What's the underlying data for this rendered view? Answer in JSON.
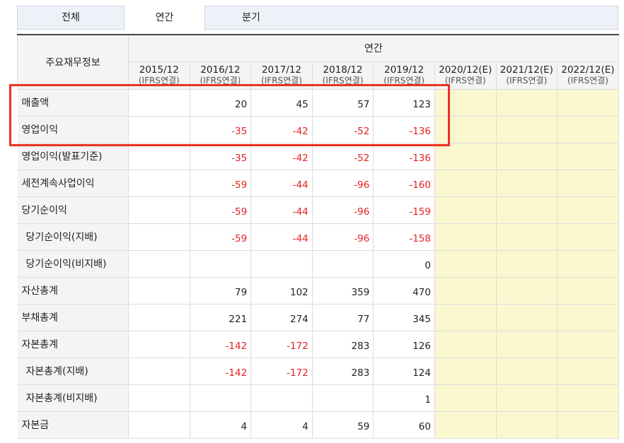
{
  "tabs": [
    {
      "label": "전체",
      "active": false
    },
    {
      "label": "연간",
      "active": true
    },
    {
      "label": "분기",
      "active": false
    }
  ],
  "table": {
    "row_header": "주요재무정보",
    "group_header": "연간",
    "columns": [
      {
        "year": "2015/12",
        "basis": "(IFRS연결)"
      },
      {
        "year": "2016/12",
        "basis": "(IFRS연결)"
      },
      {
        "year": "2017/12",
        "basis": "(IFRS연결)"
      },
      {
        "year": "2018/12",
        "basis": "(IFRS연결)"
      },
      {
        "year": "2019/12",
        "basis": "(IFRS연결)"
      },
      {
        "year": "2020/12(E)",
        "basis": "(IFRS연결)"
      },
      {
        "year": "2021/12(E)",
        "basis": "(IFRS연결)"
      },
      {
        "year": "2022/12(E)",
        "basis": "(IFRS연결)"
      }
    ],
    "rows": [
      {
        "label": "매출액",
        "indent": false,
        "values": [
          "",
          "20",
          "45",
          "57",
          "123",
          "",
          "",
          ""
        ]
      },
      {
        "label": "영업이익",
        "indent": false,
        "values": [
          "",
          "-35",
          "-42",
          "-52",
          "-136",
          "",
          "",
          ""
        ]
      },
      {
        "label": "영업이익(발표기준)",
        "indent": false,
        "values": [
          "",
          "-35",
          "-42",
          "-52",
          "-136",
          "",
          "",
          ""
        ]
      },
      {
        "label": "세전계속사업이익",
        "indent": false,
        "values": [
          "",
          "-59",
          "-44",
          "-96",
          "-160",
          "",
          "",
          ""
        ]
      },
      {
        "label": "당기순이익",
        "indent": false,
        "values": [
          "",
          "-59",
          "-44",
          "-96",
          "-159",
          "",
          "",
          ""
        ]
      },
      {
        "label": "당기순이익(지배)",
        "indent": true,
        "values": [
          "",
          "-59",
          "-44",
          "-96",
          "-158",
          "",
          "",
          ""
        ]
      },
      {
        "label": "당기순이익(비지배)",
        "indent": true,
        "values": [
          "",
          "",
          "",
          "",
          "0",
          "",
          "",
          ""
        ]
      },
      {
        "label": "자산총계",
        "indent": false,
        "values": [
          "",
          "79",
          "102",
          "359",
          "470",
          "",
          "",
          ""
        ]
      },
      {
        "label": "부채총계",
        "indent": false,
        "values": [
          "",
          "221",
          "274",
          "77",
          "345",
          "",
          "",
          ""
        ]
      },
      {
        "label": "자본총계",
        "indent": false,
        "values": [
          "",
          "-142",
          "-172",
          "283",
          "126",
          "",
          "",
          ""
        ]
      },
      {
        "label": "자본총계(지배)",
        "indent": true,
        "values": [
          "",
          "-142",
          "-172",
          "283",
          "124",
          "",
          "",
          ""
        ]
      },
      {
        "label": "자본총계(비지배)",
        "indent": true,
        "values": [
          "",
          "",
          "",
          "",
          "1",
          "",
          "",
          ""
        ]
      },
      {
        "label": "자본금",
        "indent": false,
        "values": [
          "",
          "4",
          "4",
          "59",
          "60",
          "",
          "",
          ""
        ]
      }
    ]
  },
  "colors": {
    "negative": "#e22222",
    "estimate_bg": "#fbf7cf",
    "highlight_border": "#ea3223"
  }
}
